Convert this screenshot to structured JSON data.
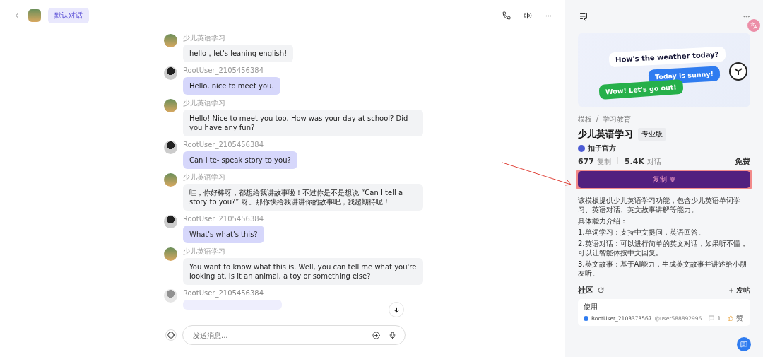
{
  "header": {
    "chat_title": "默认对话"
  },
  "messages": [
    {
      "kind": "bot",
      "sender": "少儿英语学习",
      "text": "hello，let's leaning english!"
    },
    {
      "kind": "user",
      "sender": "RootUser_2105456384",
      "text": "Hello, nice to meet you."
    },
    {
      "kind": "bot",
      "sender": "少儿英语学习",
      "text": "Hello! Nice to meet you too. How was your day at school? Did you have any fun?"
    },
    {
      "kind": "user",
      "sender": "RootUser_2105456384",
      "text": "Can I te- speak story to you?"
    },
    {
      "kind": "bot",
      "sender": "少儿英语学习",
      "text": "哇，你好棒呀，都想给我讲故事啦！不过你是不是想说 “Can I tell a story to you?” 呀。那你快给我讲讲你的故事吧，我超期待呢！"
    },
    {
      "kind": "user",
      "sender": "RootUser_2105456384",
      "text": "What's what's this?"
    },
    {
      "kind": "bot",
      "sender": "少儿英语学习",
      "text": "You want to know what this is. Well, you can tell me what you're looking at. Is it an animal, a toy or something else?"
    },
    {
      "kind": "faded",
      "sender": "RootUser_2105456384"
    }
  ],
  "composer": {
    "placeholder": "发送消息..."
  },
  "banner": {
    "bubbles": [
      "How's the weather today?",
      "Today is sunny!",
      "Wow! Let's go out!"
    ]
  },
  "breadcrumb": [
    "模板",
    "/",
    "学习教育"
  ],
  "bot": {
    "name": "少儿英语学习",
    "badge": "专业版",
    "author": "扣子官方",
    "copies": "677",
    "copies_label": "复制",
    "chats": "5.4K",
    "chats_label": "对话",
    "price": "免费"
  },
  "copy_button": {
    "label": "复制",
    "highlighted": true
  },
  "description": [
    "该模板提供少儿英语学习功能，包含少儿英语单词学习、英语对话、英文故事讲解等能力。",
    "具体能力介绍：",
    "1.单词学习：支持中文提问，英语回答。",
    "2.英语对话：可以进行简单的英文对话，如果听不懂，可以让智能体按中文回复。",
    "3.英文故事：基于AI能力，生成英文故事并讲述给小朋友听。"
  ],
  "community": {
    "title": "社区",
    "post_action": "发帖",
    "posts": [
      {
        "title": "使用",
        "user": "RootUser_2103373567",
        "handle": "@user588892996",
        "comments": "1",
        "like": "赞"
      }
    ]
  }
}
